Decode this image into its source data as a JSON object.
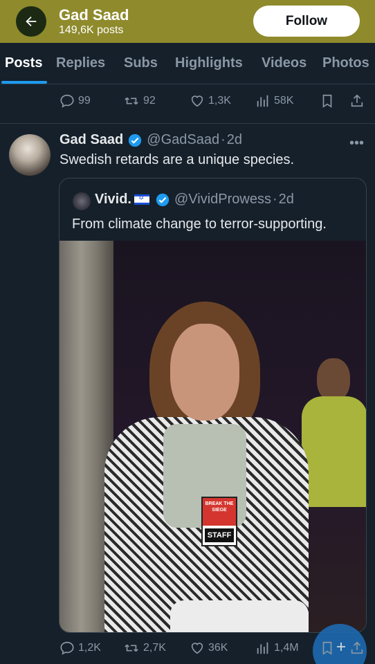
{
  "header": {
    "title": "Gad Saad",
    "post_count": "149,6K posts",
    "follow_label": "Follow"
  },
  "tabs": [
    {
      "label": "Posts",
      "active": true
    },
    {
      "label": "Replies"
    },
    {
      "label": "Subs"
    },
    {
      "label": "Highlights"
    },
    {
      "label": "Videos"
    },
    {
      "label": "Photos"
    }
  ],
  "prev_post": {
    "replies": "99",
    "reposts": "92",
    "likes": "1,3K",
    "views": "58K"
  },
  "post": {
    "author_name": "Gad Saad",
    "handle": "@GadSaad",
    "time": "2d",
    "text": "Swedish retards are a unique species.",
    "quote": {
      "author_name": "Vivid.",
      "handle": "@VividProwess",
      "time": "2d",
      "text": "From climate change to terror-supporting.",
      "badge_top": "BREAK THE SIEGE",
      "badge_bottom": "STAFF"
    },
    "stats": {
      "replies": "1,2K",
      "reposts": "2,7K",
      "likes": "36K",
      "views": "1,4M"
    }
  },
  "colors": {
    "accent": "#1d9bf0",
    "header_bg": "#8f8a2c",
    "background": "#15202b"
  }
}
